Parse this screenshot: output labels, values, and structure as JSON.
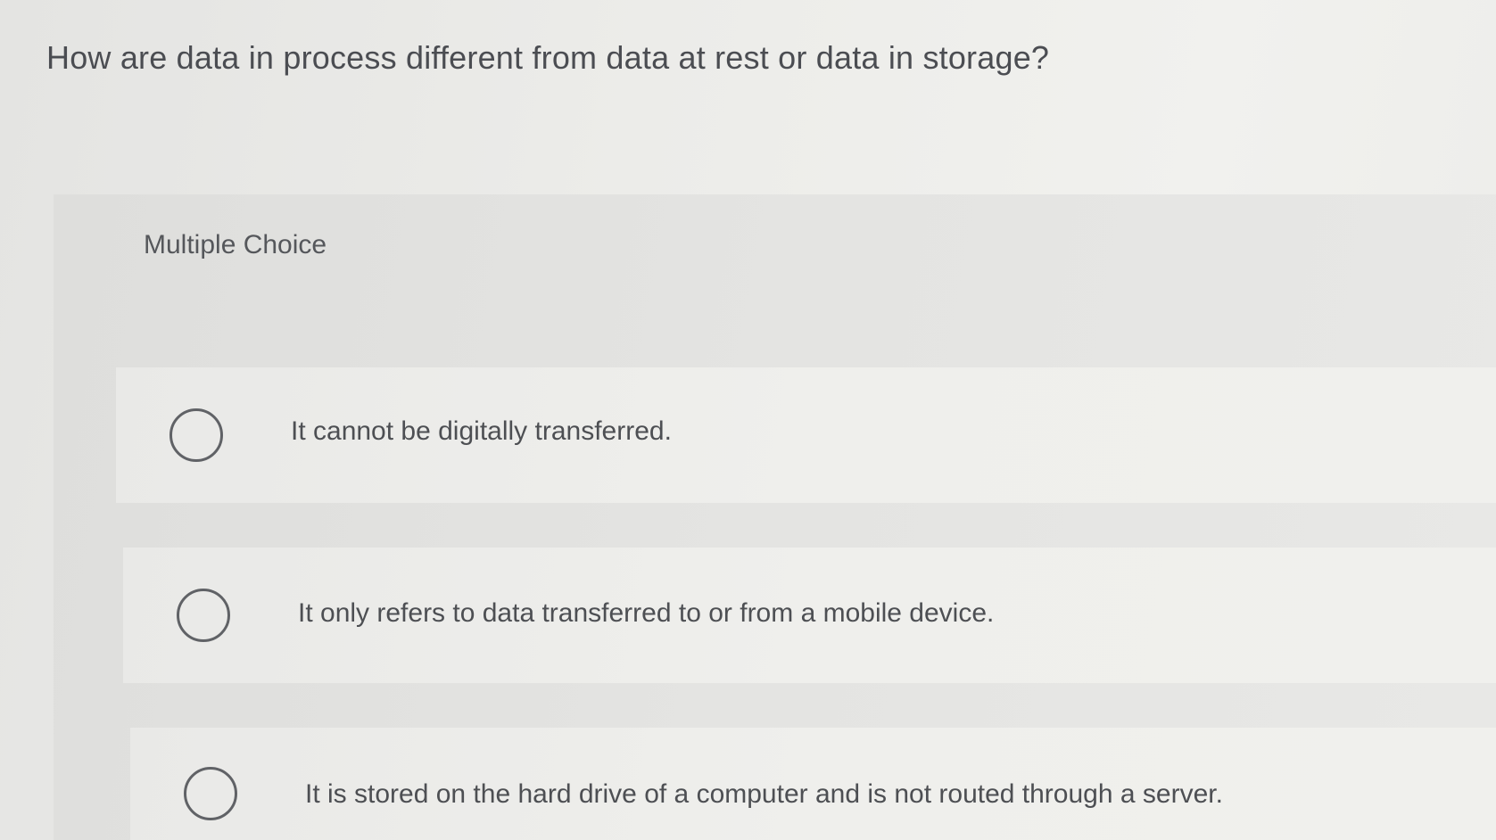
{
  "question": {
    "text": "How are data in process different from data at rest or data in storage?"
  },
  "choice_panel": {
    "label": "Multiple Choice",
    "options": [
      {
        "text": "It cannot be digitally transferred.",
        "selected": false
      },
      {
        "text": "It only refers to data transferred to or from a mobile device.",
        "selected": false
      },
      {
        "text": "It is stored on the hard drive of a computer and is not routed through a server.",
        "selected": false
      }
    ]
  }
}
